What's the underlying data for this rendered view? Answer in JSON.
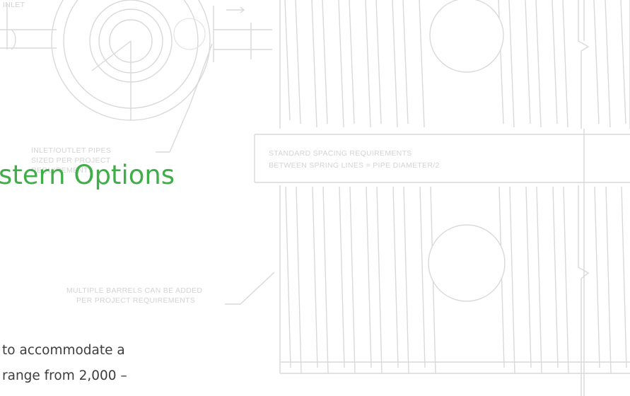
{
  "heading": "stern Options",
  "body": {
    "line1": "to accommodate a",
    "line2": "range from 2,000 –"
  },
  "drawing_labels": {
    "inlet": "INLET",
    "inlet_outlet_1": "INLET/OUTLET PIPES",
    "inlet_outlet_2": "SIZED PER PROJECT",
    "inlet_outlet_3": "REQUIREMENTS",
    "spacing_1": "STANDARD SPACING REQUIREMENTS",
    "spacing_2": "BETWEEN SPRING LINES = PIPE DIAMETER/2",
    "barrels_1": "MULTIPLE BARRELS CAN BE ADDED",
    "barrels_2": "PER PROJECT REQUIREMENTS"
  },
  "colors": {
    "heading": "#3fae49",
    "body_text": "#3d3d3d",
    "drawing": "#d9d9d9"
  }
}
